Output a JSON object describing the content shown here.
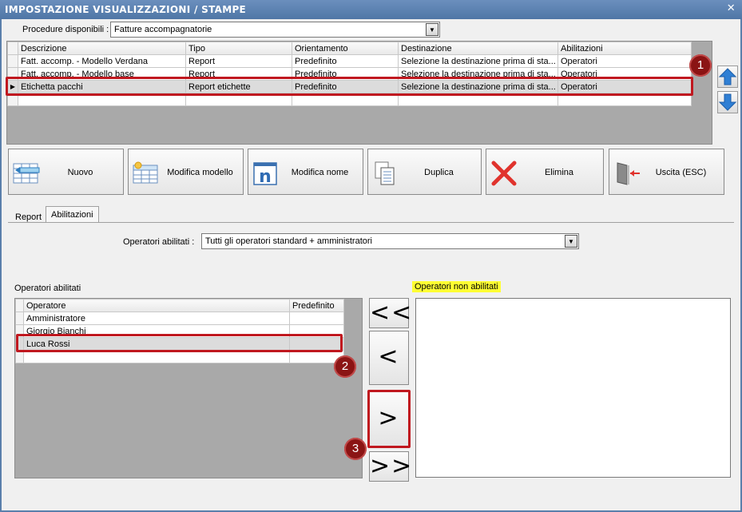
{
  "window": {
    "title": "IMPOSTAZIONE VISUALIZZAZIONI / STAMPE",
    "close": "✕"
  },
  "procedure": {
    "label": "Procedure disponibili :",
    "value": "Fatture accompagnatorie"
  },
  "grid1": {
    "headers": [
      "Descrizione",
      "Tipo",
      "Orientamento",
      "Destinazione",
      "Abilitazioni"
    ],
    "rows": [
      [
        "Fatt. accomp. - Modello Verdana",
        "Report",
        "Predefinito",
        "Selezione la destinazione prima di sta...",
        "Operatori"
      ],
      [
        "Fatt. accomp. - Modello base",
        "Report",
        "Predefinito",
        "Selezione la destinazione prima di sta...",
        "Operatori"
      ],
      [
        "Etichetta pacchi",
        "Report etichette",
        "Predefinito",
        "Selezione la destinazione prima di sta...",
        "Operatori"
      ]
    ]
  },
  "toolbar": {
    "nuovo": "Nuovo",
    "modifica_modello": "Modifica modello",
    "modifica_nome": "Modifica nome",
    "duplica": "Duplica",
    "elimina": "Elimina",
    "uscita": "Uscita (ESC)"
  },
  "tabs": [
    "Report",
    "Abilitazioni"
  ],
  "operatori_abilitati_combo": {
    "label": "Operatori abilitati :",
    "value": "Tutti gli operatori standard + amministratori"
  },
  "list_abilitati": {
    "title": "Operatori abilitati",
    "headers": [
      "Operatore",
      "Predefinito"
    ],
    "rows": [
      "Amministratore",
      "Giorgio Bianchi",
      "Luca Rossi"
    ]
  },
  "list_non_abilitati": {
    "title": "Operatori non abilitati"
  },
  "move_buttons": {
    "all_left": "<<",
    "left": "<",
    "right": ">",
    "all_right": ">>"
  },
  "badges": [
    "1",
    "2",
    "3"
  ],
  "colors": {
    "title_bar": "#5a7fab",
    "red_highlight": "#c0181f",
    "badge": "#8b1414",
    "label_highlight": "#ffff33"
  }
}
